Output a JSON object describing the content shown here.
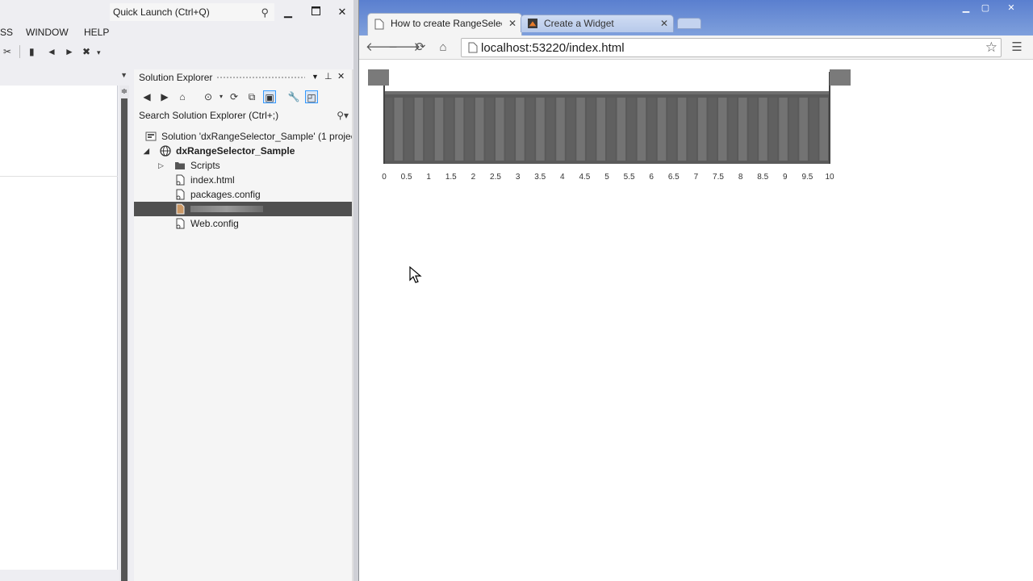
{
  "vs": {
    "quick_launch": "Quick Launch (Ctrl+Q)",
    "menu": [
      "SS",
      "WINDOW",
      "HELP"
    ],
    "window_controls": {
      "minimize": "▬",
      "maximize": "▢",
      "close": "✕"
    }
  },
  "solution_explorer": {
    "title": "Solution Explorer",
    "search_placeholder": "Search Solution Explorer (Ctrl+;)",
    "tree": [
      {
        "label": "Solution 'dxRangeSelector_Sample' (1 projec",
        "icon": "solution-icon"
      },
      {
        "label": "dxRangeSelector_Sample",
        "icon": "web-project-icon",
        "bold": true
      },
      {
        "label": "Scripts",
        "icon": "folder-icon"
      },
      {
        "label": "index.html",
        "icon": "html-file-icon"
      },
      {
        "label": "packages.config",
        "icon": "config-file-icon"
      },
      {
        "label": "",
        "icon": "file-icon",
        "selected": true
      },
      {
        "label": "Web.config",
        "icon": "config-file-icon"
      }
    ]
  },
  "browser": {
    "tabs": [
      {
        "title": "How to create RangeSelec",
        "active": true
      },
      {
        "title": "Create a Widget",
        "active": false
      }
    ],
    "url": "localhost:53220/index.html"
  },
  "chart_data": {
    "type": "range-selector",
    "scale_min": 0,
    "scale_max": 10,
    "tick_labels": [
      "0",
      "0.5",
      "1",
      "1.5",
      "2",
      "2.5",
      "3",
      "3.5",
      "4",
      "4.5",
      "5",
      "5.5",
      "6",
      "6.5",
      "7",
      "7.5",
      "8",
      "8.5",
      "9",
      "9.5",
      "10"
    ],
    "selected_range": [
      0,
      10
    ],
    "colors": {
      "background_band": "#5a5a5a",
      "handle": "#7a7a7a",
      "tick_text": "#333333"
    }
  }
}
